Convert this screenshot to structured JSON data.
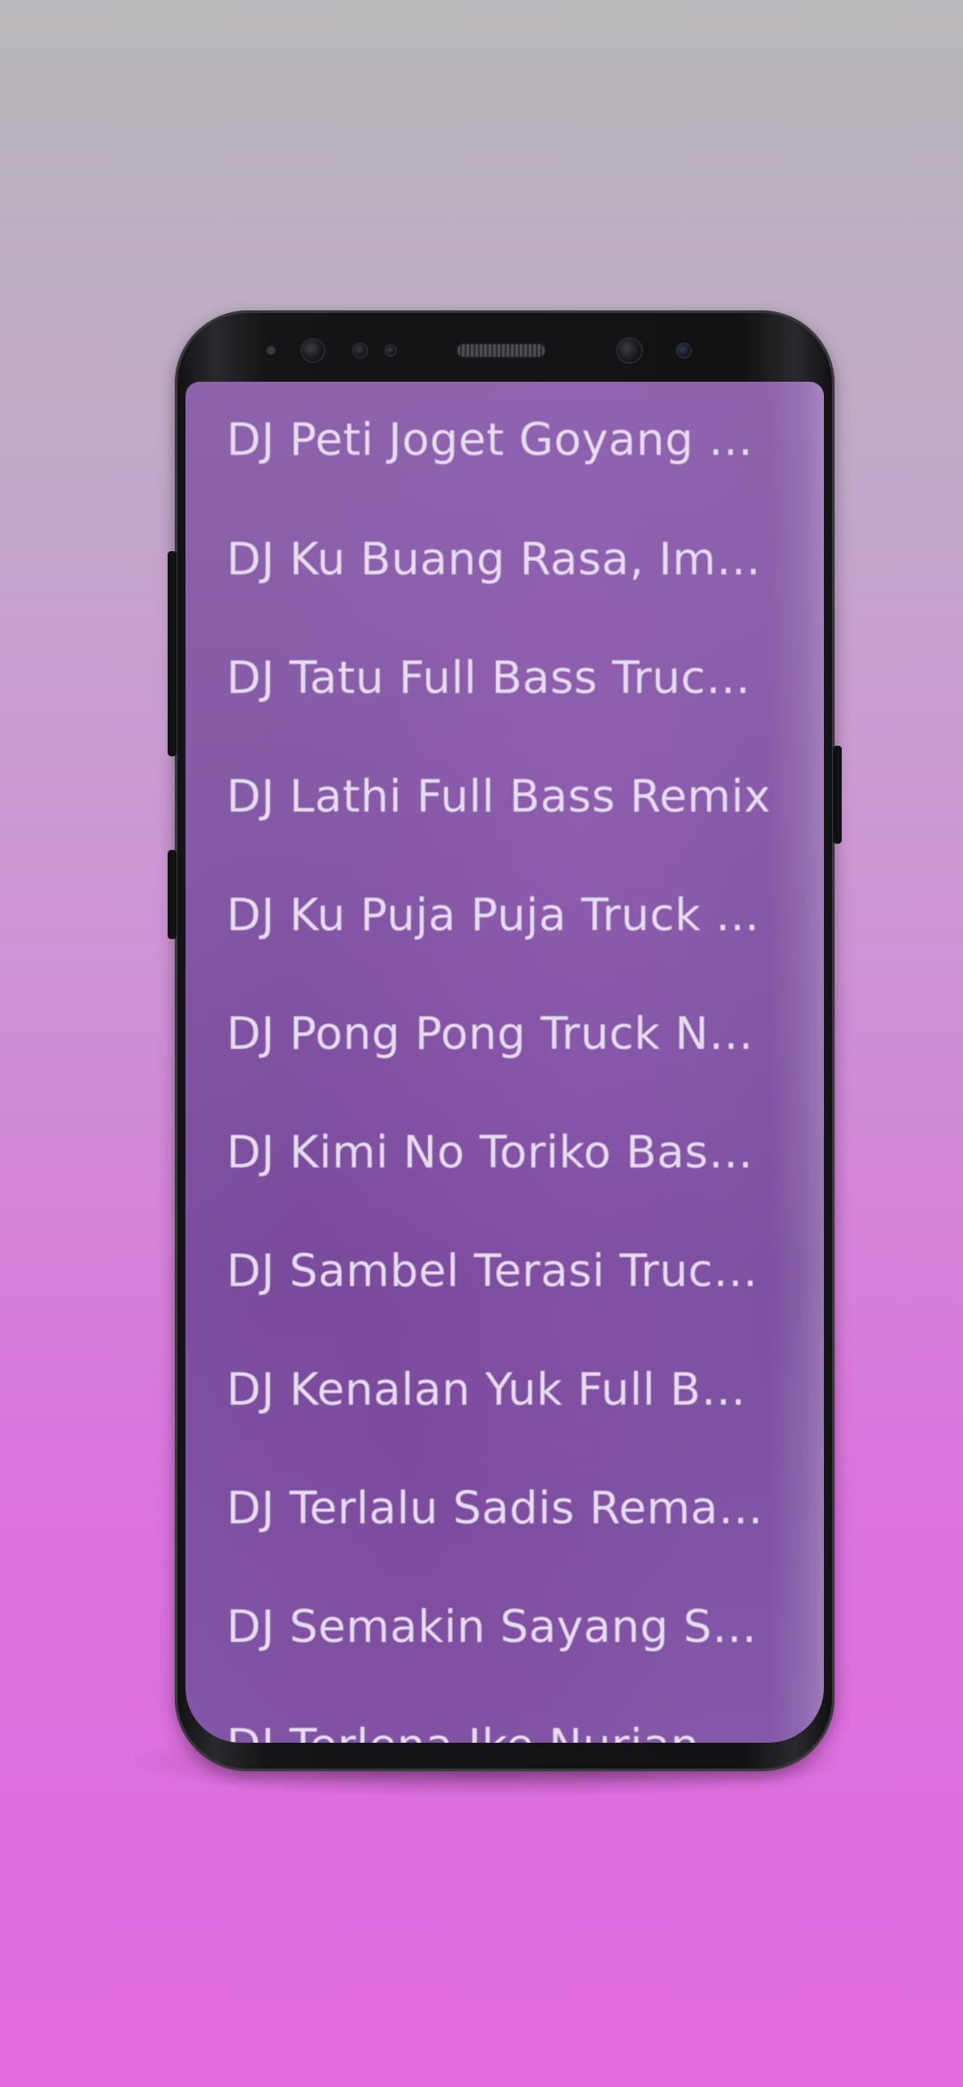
{
  "app": {
    "songs": [
      {
        "title": "DJ Peti Joget Goyang T..."
      },
      {
        "title": "DJ Ku Buang Rasa, Imp..."
      },
      {
        "title": "DJ Tatu Full Bass Truck ..."
      },
      {
        "title": "DJ Lathi Full Bass Remix"
      },
      {
        "title": "DJ Ku Puja Puja Truck ..."
      },
      {
        "title": "DJ Pong Pong Truck Nd..."
      },
      {
        "title": "DJ Kimi No Toriko Bass ..."
      },
      {
        "title": "DJ Sambel Terasi Truck ..."
      },
      {
        "title": "DJ Kenalan Yuk Full Bas..."
      },
      {
        "title": "DJ Terlalu Sadis Remak..."
      },
      {
        "title": "DJ Semakin Sayang Se..."
      },
      {
        "title": "DJ Terlena Ike Nurjanna..."
      }
    ]
  },
  "colors": {
    "background_top": "#b9b9ba",
    "background_bottom": "#e06ae0",
    "screen_purple": "#8359a5",
    "text": "#e6dcef",
    "phone_body": "#121214"
  },
  "icons": [
    "front-camera-icon",
    "earpiece-speaker-icon",
    "iris-scanner-icon",
    "proximity-sensor-icon"
  ]
}
